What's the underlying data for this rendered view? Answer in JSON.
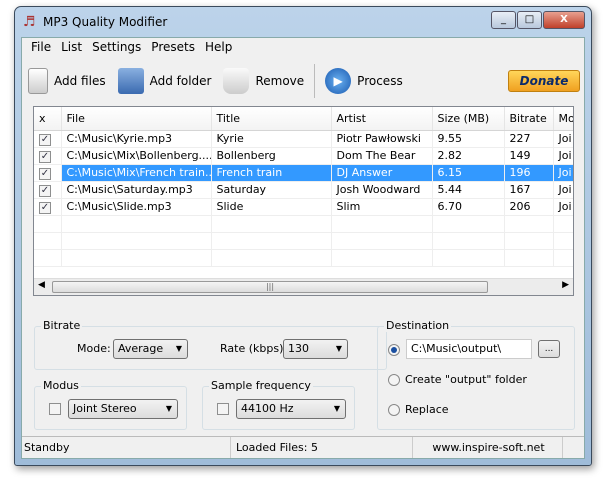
{
  "window": {
    "title": "MP3 Quality Modifier",
    "min": "_",
    "max": "□",
    "close": "X"
  },
  "menu": [
    "File",
    "List",
    "Settings",
    "Presets",
    "Help"
  ],
  "toolbar": {
    "add_files": "Add files",
    "add_folder": "Add folder",
    "remove": "Remove",
    "process": "Process",
    "donate": "Donate"
  },
  "list": {
    "columns": [
      "x",
      "File",
      "Title",
      "Artist",
      "Size  (MB)",
      "Bitrate",
      "Mo"
    ],
    "rows": [
      {
        "file": "C:\\Music\\Kyrie.mp3",
        "title": "Kyrie",
        "artist": "Piotr Pawłowski",
        "size": "9.55",
        "bitrate": "227",
        "mode": "Joi",
        "checked": true
      },
      {
        "file": "C:\\Music\\Mix\\Bollenberg....",
        "title": "Bollenberg",
        "artist": "Dom The Bear",
        "size": "2.82",
        "bitrate": "149",
        "mode": "Joi",
        "checked": true
      },
      {
        "file": "C:\\Music\\Mix\\French train....",
        "title": "French train",
        "artist": "DJ Answer",
        "size": "6.15",
        "bitrate": "196",
        "mode": "Joi",
        "checked": true,
        "selected": true
      },
      {
        "file": "C:\\Music\\Saturday.mp3",
        "title": "Saturday",
        "artist": "Josh Woodward",
        "size": "5.44",
        "bitrate": "167",
        "mode": "Joi",
        "checked": true
      },
      {
        "file": "C:\\Music\\Slide.mp3",
        "title": "Slide",
        "artist": "Slim",
        "size": "6.70",
        "bitrate": "206",
        "mode": "Joi",
        "checked": true
      }
    ],
    "scroll_grip": "|||"
  },
  "bitrate": {
    "legend": "Bitrate",
    "mode_label": "Mode:",
    "mode_value": "Average",
    "rate_label": "Rate (kbps):",
    "rate_value": "130"
  },
  "modus": {
    "legend": "Modus",
    "value": "Joint Stereo",
    "checked": false
  },
  "sample": {
    "legend": "Sample frequency",
    "value": "44100 Hz",
    "checked": false
  },
  "destination": {
    "legend": "Destination",
    "path": "C:\\Music\\output\\",
    "browse": "...",
    "create_option": "Create \"output\" folder",
    "replace_option": "Replace",
    "selected": "path"
  },
  "status": {
    "state": "Standby",
    "loaded": "Loaded Files: 5",
    "website": "www.inspire-soft.net"
  }
}
